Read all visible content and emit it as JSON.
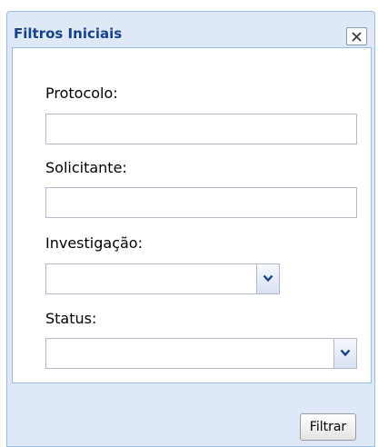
{
  "window": {
    "title": "Filtros Iniciais"
  },
  "form": {
    "protocolo": {
      "label": "Protocolo:",
      "value": ""
    },
    "solicitante": {
      "label": "Solicitante:",
      "value": ""
    },
    "investigacao": {
      "label": "Investigação:",
      "selected": ""
    },
    "status": {
      "label": "Status:",
      "selected": ""
    }
  },
  "footer": {
    "filter_label": "Filtrar"
  },
  "icons": {
    "close": "close-icon",
    "dropdown": "chevron-down-icon"
  },
  "colors": {
    "frame": "#dfe8f6",
    "title_text": "#15428b",
    "border": "#99bbe8",
    "field_border": "#b5b8c8"
  }
}
